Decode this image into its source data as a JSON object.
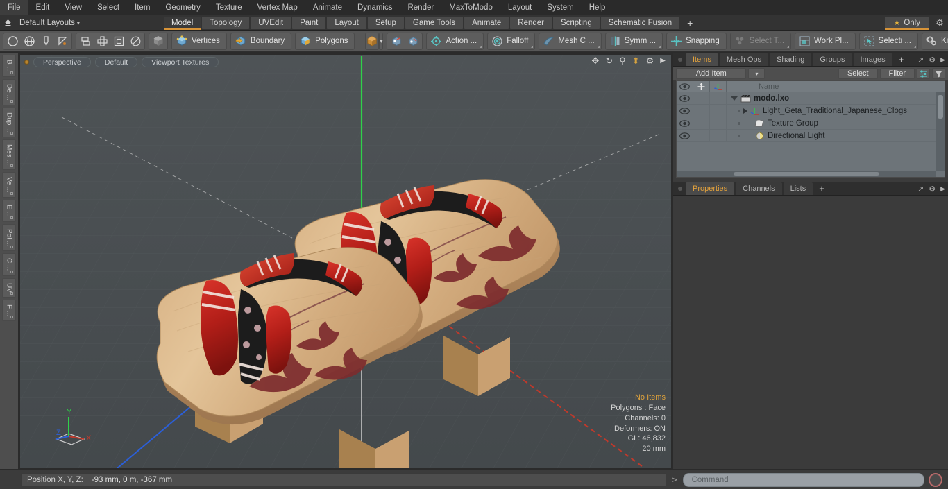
{
  "app": {
    "title": "modo"
  },
  "menubar": {
    "items": [
      {
        "label": "File"
      },
      {
        "label": "Edit"
      },
      {
        "label": "View"
      },
      {
        "label": "Select"
      },
      {
        "label": "Item"
      },
      {
        "label": "Geometry"
      },
      {
        "label": "Texture"
      },
      {
        "label": "Vertex Map"
      },
      {
        "label": "Animate"
      },
      {
        "label": "Dynamics"
      },
      {
        "label": "Render"
      },
      {
        "label": "MaxToModo"
      },
      {
        "label": "Layout"
      },
      {
        "label": "System"
      },
      {
        "label": "Help"
      }
    ]
  },
  "layoutbar": {
    "home_icon": "home-icon",
    "layouts_label": "Default Layouts",
    "caret": "▾",
    "tabs": [
      {
        "label": "Model",
        "active": true
      },
      {
        "label": "Topology",
        "active": false
      },
      {
        "label": "UVEdit",
        "active": false
      },
      {
        "label": "Paint",
        "active": false
      },
      {
        "label": "Layout",
        "active": false
      },
      {
        "label": "Setup",
        "active": false
      },
      {
        "label": "Game Tools",
        "active": false
      },
      {
        "label": "Animate",
        "active": false
      },
      {
        "label": "Render",
        "active": false
      },
      {
        "label": "Scripting",
        "active": false
      },
      {
        "label": "Schematic Fusion",
        "active": false
      }
    ],
    "add_tab_label": "+",
    "only_label": "Only",
    "star_icon": "star-icon",
    "gear_icon": "gear-icon"
  },
  "toolbar": {
    "shape_icons": [
      "circle-icon",
      "globe-icon",
      "pen-icon",
      "curve-icon"
    ],
    "arrange_icons": [
      "align-icon",
      "center-icon",
      "square-in-square-icon",
      "circle-in-square-icon"
    ],
    "item_mode_icon": "cube-grey-icon",
    "selection_modes": [
      {
        "label": "Vertices",
        "icon": "vertices-cube-icon"
      },
      {
        "label": "Boundary",
        "icon": "boundary-cube-icon"
      },
      {
        "label": "Polygons",
        "icon": "polygons-cube-icon"
      }
    ],
    "cube_icon": "cube-orange-icon",
    "dropdown_caret": "▾",
    "falloff_icons": [
      "snap-cube-a-icon",
      "snap-cube-b-icon"
    ],
    "buttons": [
      {
        "label": "Action   ...",
        "icon": "action-center-icon",
        "dim": false
      },
      {
        "label": "Falloff",
        "icon": "falloff-icon",
        "dim": false
      },
      {
        "label": "Mesh C ...",
        "icon": "mesh-constraint-icon",
        "dim": false
      },
      {
        "label": "Symm ...",
        "icon": "symmetry-icon",
        "dim": false
      },
      {
        "label": "Snapping",
        "icon": "snapping-icon",
        "dim": false
      },
      {
        "label": "Select T...",
        "icon": "select-through-icon",
        "dim": true
      },
      {
        "label": "Work Pl...",
        "icon": "work-plane-icon",
        "dim": false
      },
      {
        "label": "Selecti  ...",
        "icon": "selection-set-icon",
        "dim": false
      },
      {
        "label": "Kits",
        "icon": "kits-icon",
        "dim": false
      }
    ],
    "right_icons": [
      "modo-badge-icon",
      "unreal-badge-icon"
    ]
  },
  "left_strip": {
    "tabs": [
      {
        "label": "B ..."
      },
      {
        "label": "De ..."
      },
      {
        "label": "Dup ..."
      },
      {
        "label": "Mes ..."
      },
      {
        "label": "Ve ..."
      },
      {
        "label": "E ..."
      },
      {
        "label": "Pol ..."
      },
      {
        "label": "C ..."
      },
      {
        "label": "UV"
      },
      {
        "label": "F ..."
      }
    ]
  },
  "viewport": {
    "dot_icon": "viewport-active-dot",
    "pills": [
      {
        "label": "Perspective"
      },
      {
        "label": "Default"
      },
      {
        "label": "Viewport Textures"
      }
    ],
    "tool_icons": [
      "move-icon",
      "rotate-icon",
      "zoom-icon",
      "fit-icon",
      "gear-icon",
      "play-icon"
    ],
    "stats": {
      "selection": "No Items",
      "polygons": "Polygons : Face",
      "channels": "Channels: 0",
      "deformers": "Deformers: ON",
      "gl": "GL: 46,832",
      "scale": "20 mm"
    },
    "gizmo": {
      "x": "X",
      "y": "Y",
      "z": "Z"
    },
    "scene_description": "Pair of traditional Japanese geta wooden clogs with red and black floral straps and maple leaf decoration"
  },
  "items_panel": {
    "tabs": [
      {
        "label": "Items",
        "active": true
      },
      {
        "label": "Mesh Ops",
        "active": false
      },
      {
        "label": "Shading",
        "active": false
      },
      {
        "label": "Groups",
        "active": false
      },
      {
        "label": "Images",
        "active": false
      },
      {
        "label": "+",
        "active": false
      }
    ],
    "corner_icons": [
      "expand-icon",
      "gear-icon",
      "chevron-right-icon"
    ],
    "add_item_label": "Add Item",
    "add_item_caret": "▾",
    "select_label": "Select",
    "filter_label": "Filter",
    "list_icon_buttons": [
      "list-options-icon",
      "filter-funnel-icon"
    ],
    "columns": {
      "eye": "eye-icon",
      "lock": "transform-icon",
      "axis": "axis-icon",
      "name": "Name"
    },
    "rows": [
      {
        "name": "modo.lxo",
        "icon": "scene-clapper-icon",
        "depth": 0,
        "bold": true,
        "twisty": "down"
      },
      {
        "name": "Light_Geta_Traditional_Japanese_Clogs",
        "icon": "locator-axis-icon",
        "depth": 1,
        "bold": false,
        "twisty": "right"
      },
      {
        "name": "Texture Group",
        "icon": "texture-group-icon",
        "depth": 1,
        "bold": false,
        "twisty": "none"
      },
      {
        "name": "Directional Light",
        "icon": "directional-light-icon",
        "depth": 1,
        "bold": false,
        "twisty": "none"
      }
    ]
  },
  "properties_panel": {
    "tabs": [
      {
        "label": "Properties",
        "active": true
      },
      {
        "label": "Channels",
        "active": false
      },
      {
        "label": "Lists",
        "active": false
      },
      {
        "label": "+",
        "active": false
      }
    ],
    "corner_icons": [
      "expand-icon",
      "gear-icon",
      "chevron-right-icon"
    ]
  },
  "statusbar": {
    "position_label": "Position X, Y, Z:",
    "position_value": "-93 mm, 0 m, -367 mm",
    "command_prompt": ">",
    "command_placeholder": "Command",
    "record_icon": "record-icon"
  },
  "colors": {
    "accent": "#e3a23c",
    "toolbar_bg": "#575757",
    "panel_bg": "#3b3b3b",
    "viewport_bg": "#4a4f52",
    "list_bg": "#6d7479",
    "axis_x": "#c0392b",
    "axis_y": "#2ecc40",
    "axis_z": "#2b5fd9"
  }
}
